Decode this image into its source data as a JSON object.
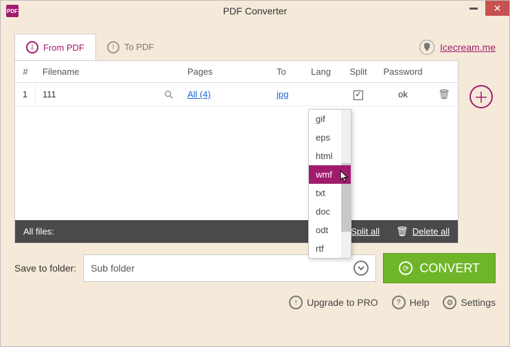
{
  "window": {
    "title": "PDF Converter"
  },
  "tabs": {
    "from": "From PDF",
    "to": "To PDF"
  },
  "brand": "Icecream.me",
  "columns": {
    "num": "#",
    "filename": "Filename",
    "pages": "Pages",
    "to": "To",
    "lang": "Lang",
    "split": "Split",
    "password": "Password"
  },
  "rows": [
    {
      "num": "1",
      "filename": "111",
      "pages_label": "All (4)",
      "to": "jpg",
      "lang": "",
      "split_checked": true,
      "password": "ok"
    }
  ],
  "allfiles": {
    "label": "All files:",
    "split_all": "Split all",
    "delete_all": "Delete all"
  },
  "save": {
    "label": "Save to folder:",
    "value": "Sub folder"
  },
  "convert": "CONVERT",
  "footer": {
    "upgrade": "Upgrade to PRO",
    "help": "Help",
    "settings": "Settings"
  },
  "dropdown": {
    "selected": "wmf",
    "items": [
      "gif",
      "eps",
      "html",
      "wmf",
      "txt",
      "doc",
      "odt",
      "rtf"
    ]
  }
}
